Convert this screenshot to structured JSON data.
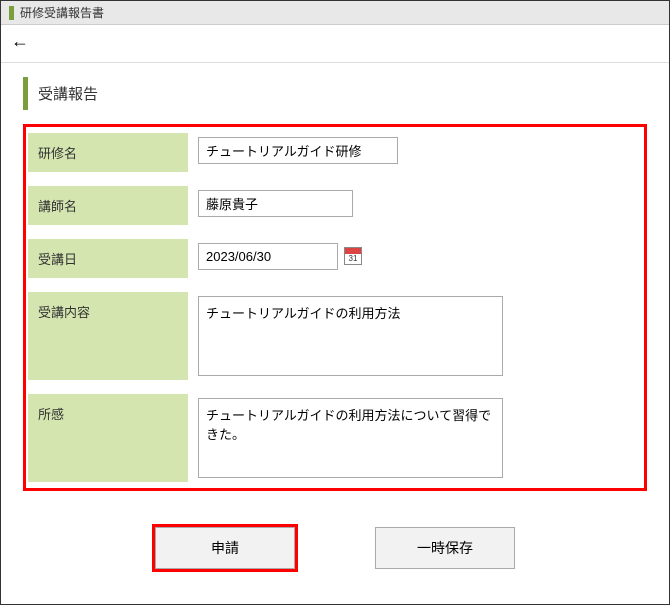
{
  "header": {
    "title": "研修受講報告書"
  },
  "section": {
    "title": "受講報告"
  },
  "form": {
    "trainingName": {
      "label": "研修名",
      "value": "チュートリアルガイド研修"
    },
    "instructor": {
      "label": "講師名",
      "value": "藤原貴子"
    },
    "attendDate": {
      "label": "受講日",
      "value": "2023/06/30",
      "calDay": "31"
    },
    "content": {
      "label": "受講内容",
      "value": "チュートリアルガイドの利用方法"
    },
    "impression": {
      "label": "所感",
      "value": "チュートリアルガイドの利用方法について習得できた。"
    }
  },
  "buttons": {
    "apply": "申請",
    "saveDraft": "一時保存"
  }
}
